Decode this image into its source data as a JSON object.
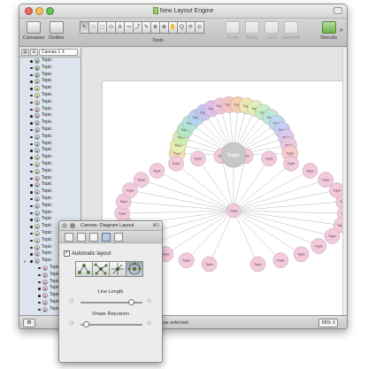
{
  "window": {
    "title": "New Layout Engine"
  },
  "toolbar": {
    "canvases": "Canvases",
    "outline": "Outline",
    "tools_label": "Tools",
    "front": "Front",
    "back": "Back",
    "lock": "Lock",
    "rebreak": "Rebreak",
    "stencils": "Stencils",
    "tool_glyphs": [
      "↖",
      "□",
      "⬚",
      "⬭",
      "A",
      "⤳",
      "⤴",
      "✎",
      "⊕",
      "⊗",
      "✋",
      "Q",
      "⟳",
      "⊙"
    ]
  },
  "sidebar": {
    "canvas_select": "Canvas 1",
    "item_label": "Topic",
    "rows": [
      {
        "level": 0,
        "color": "#9fd8a0"
      },
      {
        "level": 0,
        "color": "#9fd8a0"
      },
      {
        "level": 0,
        "color": "#a8d8b8"
      },
      {
        "level": 0,
        "color": "#c8e6a8"
      },
      {
        "level": 0,
        "color": "#e6f0a0"
      },
      {
        "level": 0,
        "color": "#f6e6a0"
      },
      {
        "level": 0,
        "color": "#f6d6a8"
      },
      {
        "level": 0,
        "color": "#f4c6c0"
      },
      {
        "level": 0,
        "color": "#eec0d8"
      },
      {
        "level": 0,
        "color": "#dcc4ea"
      },
      {
        "level": 0,
        "color": "#c8ccf0"
      },
      {
        "level": 0,
        "color": "#c4dcf0"
      },
      {
        "level": 0,
        "color": "#b8e4e4"
      },
      {
        "level": 0,
        "color": "#b8ecc8"
      },
      {
        "level": 0,
        "color": "#d0ecb0"
      },
      {
        "level": 0,
        "color": "#eaeaa8"
      },
      {
        "level": 0,
        "color": "#f6deb0"
      },
      {
        "level": 0,
        "color": "#f6ccb8"
      },
      {
        "level": 0,
        "color": "#f2c4d4"
      },
      {
        "level": 0,
        "color": "#e6c6ec"
      },
      {
        "level": 0,
        "color": "#d4cef2"
      },
      {
        "level": 0,
        "color": "#c8d8f2"
      },
      {
        "level": 0,
        "color": "#c4e8e8"
      },
      {
        "level": 0,
        "color": "#c4ecd0"
      },
      {
        "level": 0,
        "color": "#dceec0"
      },
      {
        "level": 0,
        "color": "#eeeeb8"
      },
      {
        "level": 0,
        "color": "#f2e2c0"
      },
      {
        "level": 0,
        "color": "#f2d2c8"
      },
      {
        "level": 0,
        "color": "#f0cad6"
      },
      {
        "level": 0,
        "color": "#f3c9dc",
        "expanded": true
      },
      {
        "level": 1,
        "color": "#f3c9dc"
      },
      {
        "level": 1,
        "color": "#f3c9dc"
      },
      {
        "level": 1,
        "color": "#f3c9dc"
      },
      {
        "level": 1,
        "color": "#f3c9dc"
      },
      {
        "level": 1,
        "color": "#f3c9dc"
      },
      {
        "level": 1,
        "color": "#f3c9dc"
      },
      {
        "level": 1,
        "color": "#f3c9dc"
      }
    ]
  },
  "canvas": {
    "root_label": "Topic",
    "hub_label": "Topic",
    "fan_label": "Topic",
    "pink_label": "Topic",
    "fan_colors": [
      "#f6e0b0",
      "#e8f0b0",
      "#cdeeb0",
      "#b4e8c0",
      "#b0e4dc",
      "#b4d4ee",
      "#c4c4f0",
      "#dcc0ec",
      "#eec4dc",
      "#f4c4c4",
      "#f4d0b0",
      "#f0e4b0",
      "#e0f0b8",
      "#c8ecc4",
      "#bce8dc",
      "#bcd8ee",
      "#c8ccf2",
      "#dcc8ee",
      "#ecc8e0",
      "#f4cccc"
    ]
  },
  "inspector": {
    "title": "Canvas: Diagram Layout",
    "shortcut": "⌘3",
    "automatic_layout": "Automatic layout",
    "line_length": "Line Length",
    "shape_repulsion": "Shape Repulsion",
    "line_length_value": 0.86,
    "shape_repulsion_value": 0.04
  },
  "status": {
    "text": "vas selected",
    "zoom": "65%"
  }
}
